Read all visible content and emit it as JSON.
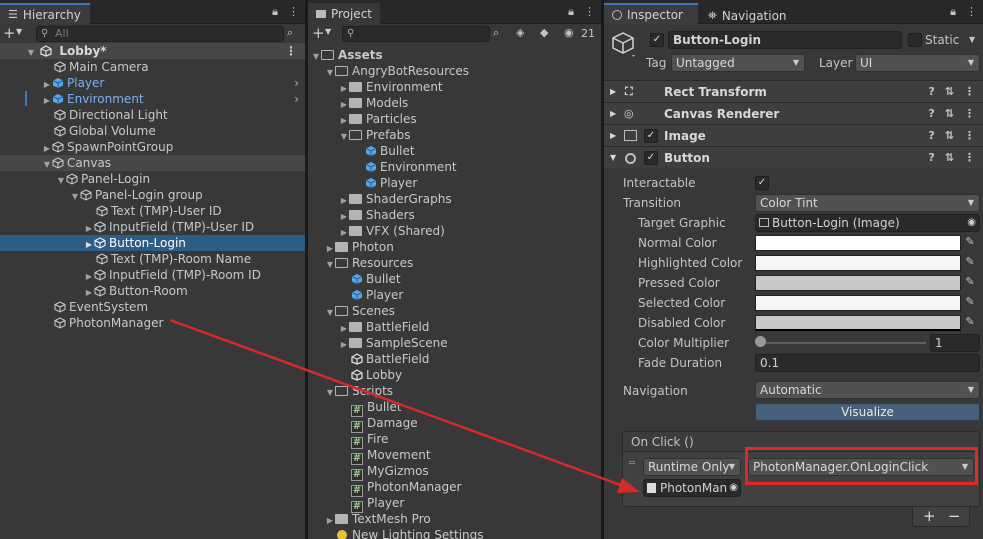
{
  "hierarchy": {
    "tab": "Hierarchy",
    "search_placeholder": "All",
    "scene": "Lobby*",
    "items": [
      {
        "label": "Main Camera"
      },
      {
        "label": "Player"
      },
      {
        "label": "Environment"
      },
      {
        "label": "Directional Light"
      },
      {
        "label": "Global Volume"
      },
      {
        "label": "SpawnPointGroup"
      },
      {
        "label": "Canvas"
      },
      {
        "label": "Panel-Login"
      },
      {
        "label": "Panel-Login group"
      },
      {
        "label": "Text (TMP)-User ID"
      },
      {
        "label": "InputField (TMP)-User ID"
      },
      {
        "label": "Button-Login"
      },
      {
        "label": "Text (TMP)-Room Name"
      },
      {
        "label": "InputField (TMP)-Room ID"
      },
      {
        "label": "Button-Room"
      },
      {
        "label": "EventSystem"
      },
      {
        "label": "PhotonManager"
      }
    ]
  },
  "project": {
    "tab": "Project",
    "count": "21",
    "items": [
      {
        "label": "Assets"
      },
      {
        "label": "AngryBotResources"
      },
      {
        "label": "Environment"
      },
      {
        "label": "Models"
      },
      {
        "label": "Particles"
      },
      {
        "label": "Prefabs"
      },
      {
        "label": "Bullet"
      },
      {
        "label": "Environment"
      },
      {
        "label": "Player"
      },
      {
        "label": "ShaderGraphs"
      },
      {
        "label": "Shaders"
      },
      {
        "label": "VFX (Shared)"
      },
      {
        "label": "Photon"
      },
      {
        "label": "Resources"
      },
      {
        "label": "Bullet"
      },
      {
        "label": "Player"
      },
      {
        "label": "Scenes"
      },
      {
        "label": "BattleField"
      },
      {
        "label": "SampleScene"
      },
      {
        "label": "BattleField"
      },
      {
        "label": "Lobby"
      },
      {
        "label": "Scripts"
      },
      {
        "label": "Bullet"
      },
      {
        "label": "Damage"
      },
      {
        "label": "Fire"
      },
      {
        "label": "Movement"
      },
      {
        "label": "MyGizmos"
      },
      {
        "label": "PhotonManager"
      },
      {
        "label": "Player"
      },
      {
        "label": "TextMesh Pro"
      },
      {
        "label": "New Lighting Settings"
      }
    ]
  },
  "inspector": {
    "tab": "Inspector",
    "tab2": "Navigation",
    "object_name": "Button-Login",
    "static_label": "Static",
    "tag_label": "Tag",
    "tag_value": "Untagged",
    "layer_label": "Layer",
    "layer_value": "UI",
    "components": [
      "Rect Transform",
      "Canvas Renderer",
      "Image",
      "Button"
    ],
    "button": {
      "interactable": "Interactable",
      "transition": "Transition",
      "transition_value": "Color Tint",
      "target_graphic": "Target Graphic",
      "target_graphic_value": "Button-Login (Image)",
      "normal_color": "Normal Color",
      "highlighted_color": "Highlighted Color",
      "pressed_color": "Pressed Color",
      "selected_color": "Selected Color",
      "disabled_color": "Disabled Color",
      "color_multiplier": "Color Multiplier",
      "color_multiplier_value": "1",
      "fade_duration": "Fade Duration",
      "fade_duration_value": "0.1",
      "navigation": "Navigation",
      "navigation_value": "Automatic",
      "visualize": "Visualize",
      "on_click": "On Click ()",
      "runtime": "Runtime Only",
      "function": "PhotonManager.OnLoginClick",
      "object": "PhotonMan",
      "plus": "+",
      "minus": "−"
    }
  },
  "colors": {
    "selection": "#2c5d87",
    "highlight_box": "#e0282b",
    "arrow": "#d42a2a",
    "prefab_blue": "#7ab3f0"
  }
}
